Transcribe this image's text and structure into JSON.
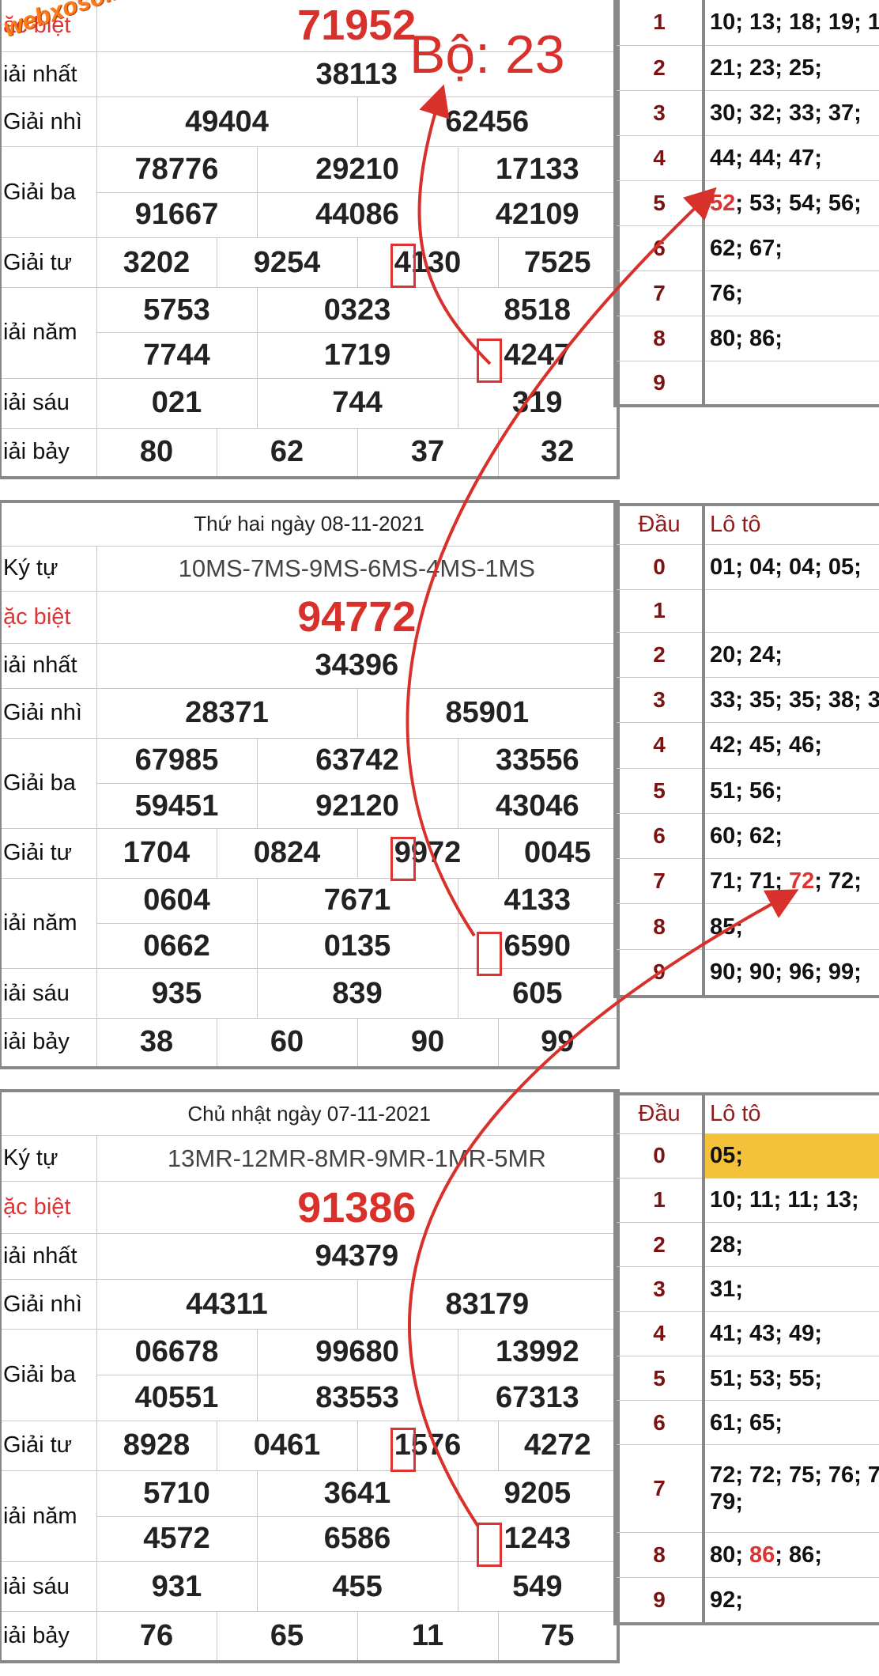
{
  "watermark": "webxoso.net",
  "annotation": "Bộ: 23",
  "colors": {
    "red": "#d8302a",
    "label_red": "#d33",
    "dau_red": "#7a1414",
    "highlight": "#f3c13a",
    "border": "#888"
  },
  "top": {
    "labels": [
      "ặc biệt",
      "iải nhất",
      "Giải nhì",
      "Giải ba",
      "Giải tư",
      "iải năm",
      "iải sáu",
      "iải bảy"
    ],
    "special": "71952",
    "first": "38113",
    "second": [
      "49404",
      "62456"
    ],
    "third": [
      "78776",
      "29210",
      "17133",
      "91667",
      "44086",
      "42109"
    ],
    "fourth": [
      "3202",
      "9254",
      "4130",
      "7525"
    ],
    "fifth": [
      "5753",
      "0323",
      "8518",
      "7744",
      "1719",
      "4247"
    ],
    "sixth": [
      "021",
      "744",
      "319"
    ],
    "seventh": [
      "80",
      "62",
      "37",
      "32"
    ]
  },
  "top_lotto": [
    {
      "d": "1",
      "n": "10; 13; 18; 19; 1"
    },
    {
      "d": "2",
      "n": "21; 23; 25;"
    },
    {
      "d": "3",
      "n": "30; 32; 33; 37;"
    },
    {
      "d": "4",
      "n": "44; 44; 47;"
    },
    {
      "d": "5",
      "pre": "",
      "hi": "52",
      "post": "; 53; 54; 56;"
    },
    {
      "d": "6",
      "n": "62; 67;"
    },
    {
      "d": "7",
      "n": "76;"
    },
    {
      "d": "8",
      "n": "80; 86;"
    },
    {
      "d": "9",
      "n": ""
    }
  ],
  "mid": {
    "date": "Thứ hai ngày 08-11-2021",
    "labels": [
      "Ký tự",
      "ặc biệt",
      "iải nhất",
      "Giải nhì",
      "Giải ba",
      "Giải tư",
      "iải năm",
      "iải sáu",
      "iải bảy"
    ],
    "code": "10MS-7MS-9MS-6MS-4MS-1MS",
    "special": "94772",
    "first": "34396",
    "second": [
      "28371",
      "85901"
    ],
    "third": [
      "67985",
      "63742",
      "33556",
      "59451",
      "92120",
      "43046"
    ],
    "fourth": [
      "1704",
      "0824",
      "9972",
      "0045"
    ],
    "fifth": [
      "0604",
      "7671",
      "4133",
      "0662",
      "0135",
      "6590"
    ],
    "sixth": [
      "935",
      "839",
      "605"
    ],
    "seventh": [
      "38",
      "60",
      "90",
      "99"
    ]
  },
  "mid_lotto": {
    "header": [
      "Đầu",
      "Lô tô"
    ],
    "rows": [
      {
        "d": "0",
        "n": "01; 04; 04; 05;"
      },
      {
        "d": "1",
        "n": ""
      },
      {
        "d": "2",
        "n": "20; 24;"
      },
      {
        "d": "3",
        "n": "33; 35; 35; 38; 3"
      },
      {
        "d": "4",
        "n": "42; 45; 46;"
      },
      {
        "d": "5",
        "n": "51; 56;"
      },
      {
        "d": "6",
        "n": "60; 62;"
      },
      {
        "d": "7",
        "pre": "71; 71; ",
        "hi": "72",
        "post": "; 72;"
      },
      {
        "d": "8",
        "n": "85;"
      },
      {
        "d": "9",
        "n": "90; 90; 96; 99;"
      }
    ]
  },
  "bot": {
    "date": "Chủ nhật ngày 07-11-2021",
    "labels": [
      "Ký tự",
      "ặc biệt",
      "iải nhất",
      "Giải nhì",
      "Giải ba",
      "Giải tư",
      "iải năm",
      "iải sáu",
      "iải bảy"
    ],
    "code": "13MR-12MR-8MR-9MR-1MR-5MR",
    "special": "91386",
    "first": "94379",
    "second": [
      "44311",
      "83179"
    ],
    "third": [
      "06678",
      "99680",
      "13992",
      "40551",
      "83553",
      "67313"
    ],
    "fourth": [
      "8928",
      "0461",
      "1576",
      "4272"
    ],
    "fifth": [
      "5710",
      "3641",
      "9205",
      "4572",
      "6586",
      "1243"
    ],
    "sixth": [
      "931",
      "455",
      "549"
    ],
    "seventh": [
      "76",
      "65",
      "11",
      "75"
    ]
  },
  "bot_lotto": {
    "header": [
      "Đầu",
      "Lô tô"
    ],
    "rows": [
      {
        "d": "0",
        "n": "05;",
        "hl": true
      },
      {
        "d": "1",
        "n": "10; 11; 11; 13;"
      },
      {
        "d": "2",
        "n": "28;"
      },
      {
        "d": "3",
        "n": "31;"
      },
      {
        "d": "4",
        "n": "41; 43; 49;"
      },
      {
        "d": "5",
        "n": "51; 53; 55;"
      },
      {
        "d": "6",
        "n": "61; 65;"
      },
      {
        "d": "7",
        "n": "72; 72; 75; 76; 7",
        "n2": "79;"
      },
      {
        "d": "8",
        "pre": "80; ",
        "hi": "86",
        "post": "; 86;"
      },
      {
        "d": "9",
        "n": "92;"
      }
    ]
  }
}
